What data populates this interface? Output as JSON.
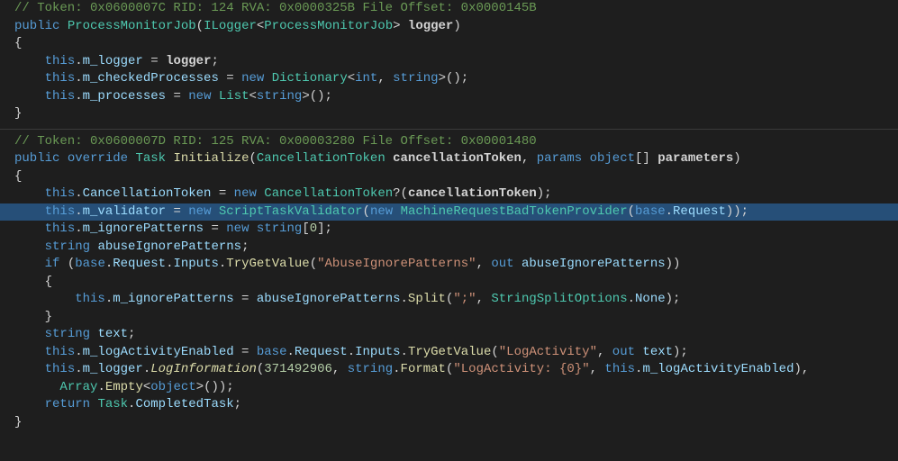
{
  "code": {
    "block1": {
      "comment": "// Token: 0x0600007C RID: 124 RVA: 0x0000325B File Offset: 0x0000145B",
      "l1": {
        "kw1": "public",
        "type1": "ProcessMonitorJob",
        "p1": "(",
        "type2": "ILogger",
        "lt": "<",
        "type3": "ProcessMonitorJob",
        "gt": ">",
        "sp": " ",
        "param": "logger",
        "p2": ")"
      },
      "l2": "{",
      "l3": {
        "sp": "    ",
        "kw": "this",
        "dot": ".",
        "f": "m_logger",
        "eq": " = ",
        "v": "logger",
        "end": ";"
      },
      "l4": {
        "sp": "    ",
        "kw": "this",
        "dot": ".",
        "f": "m_checkedProcesses",
        "eq": " = ",
        "nw": "new",
        "sp2": " ",
        "t": "Dictionary",
        "lt": "<",
        "t2": "int",
        "c": ", ",
        "t3": "string",
        "gt": ">",
        "paren": "();"
      },
      "l5": {
        "sp": "    ",
        "kw": "this",
        "dot": ".",
        "f": "m_processes",
        "eq": " = ",
        "nw": "new",
        "sp2": " ",
        "t": "List",
        "lt": "<",
        "t2": "string",
        "gt": ">",
        "paren": "();"
      },
      "l6": "}"
    },
    "block2": {
      "comment": "// Token: 0x0600007D RID: 125 RVA: 0x00003280 File Offset: 0x00001480",
      "l1": {
        "kw1": "public",
        "sp": " ",
        "kw2": "override",
        "sp2": " ",
        "t1": "Task",
        "sp3": " ",
        "m": "Initialize",
        "p1": "(",
        "t2": "CancellationToken",
        "sp4": " ",
        "a1": "cancellationToken",
        "c": ", ",
        "kw3": "params",
        "sp5": " ",
        "kw4": "object",
        "br": "[] ",
        "a2": "parameters",
        "p2": ")"
      },
      "l2": "{",
      "l3": {
        "sp": "    ",
        "kw": "this",
        "dot": ".",
        "f": "CancellationToken",
        "eq": " = ",
        "nw": "new",
        "sp2": " ",
        "t": "CancellationToken",
        "q": "?(",
        "v": "cancellationToken",
        "end": ");"
      },
      "l4": {
        "sp": "    ",
        "kw": "this",
        "dot": ".",
        "f": "m_validator",
        "eq": " = ",
        "nw": "new",
        "sp2": " ",
        "t": "ScriptTaskValidator",
        "p1": "(",
        "nw2": "new",
        "sp3": " ",
        "t2": "MachineRequestBadTokenProvider",
        "p2": "(",
        "kw2": "base",
        "dot2": ".",
        "f2": "Request",
        "end": "));"
      },
      "l5": {
        "sp": "    ",
        "kw": "this",
        "dot": ".",
        "f": "m_ignorePatterns",
        "eq": " = ",
        "nw": "new",
        "sp2": " ",
        "t": "string",
        "br": "[",
        "n": "0",
        "end": "];"
      },
      "l6": {
        "sp": "    ",
        "t": "string",
        "sp2": " ",
        "v": "abuseIgnorePatterns",
        "end": ";"
      },
      "l7": {
        "sp": "    ",
        "kw": "if",
        "p1": " (",
        "kw2": "base",
        "dot": ".",
        "f1": "Request",
        "dot2": ".",
        "f2": "Inputs",
        "dot3": ".",
        "m": "TryGetValue",
        "p2": "(",
        "s": "\"AbuseIgnorePatterns\"",
        "c": ", ",
        "kw3": "out",
        "sp2": " ",
        "v": "abuseIgnorePatterns",
        "end": "))"
      },
      "l8": {
        "sp": "    ",
        "b": "{"
      },
      "l9": {
        "sp": "        ",
        "kw": "this",
        "dot": ".",
        "f": "m_ignorePatterns",
        "eq": " = ",
        "v": "abuseIgnorePatterns",
        "dot2": ".",
        "m": "Split",
        "p1": "(",
        "s1": "\";\"",
        "c": ", ",
        "t": "StringSplitOptions",
        "dot3": ".",
        "f2": "None",
        "end": ");"
      },
      "l10": {
        "sp": "    ",
        "b": "}"
      },
      "l11": {
        "sp": "    ",
        "t": "string",
        "sp2": " ",
        "v": "text",
        "end": ";"
      },
      "l12": {
        "sp": "    ",
        "kw": "this",
        "dot": ".",
        "f": "m_logActivityEnabled",
        "eq": " = ",
        "kw2": "base",
        "dot2": ".",
        "f2": "Request",
        "dot3": ".",
        "f3": "Inputs",
        "dot4": ".",
        "m": "TryGetValue",
        "p1": "(",
        "s": "\"LogActivity\"",
        "c": ", ",
        "kw3": "out",
        "sp2": " ",
        "v": "text",
        "end": ");"
      },
      "l13": {
        "sp": "    ",
        "kw": "this",
        "dot": ".",
        "f": "m_logger",
        "dot2": ".",
        "m": "LogInformation",
        "p1": "(",
        "n": "371492906",
        "c": ", ",
        "t": "string",
        "dot3": ".",
        "m2": "Format",
        "p2": "(",
        "s": "\"LogActivity: {0}\"",
        "c2": ", ",
        "kw2": "this",
        "dot4": ".",
        "f2": "m_logActivityEnabled",
        "end": "),"
      },
      "l13b": {
        "sp": "      ",
        "t": "Array",
        "dot": ".",
        "m": "Empty",
        "lt": "<",
        "kw": "object",
        "gt": ">",
        "end": "());"
      },
      "l14": {
        "sp": "    ",
        "kw": "return",
        "sp2": " ",
        "t": "Task",
        "dot": ".",
        "f": "CompletedTask",
        "end": ";"
      },
      "l15": "}"
    }
  }
}
